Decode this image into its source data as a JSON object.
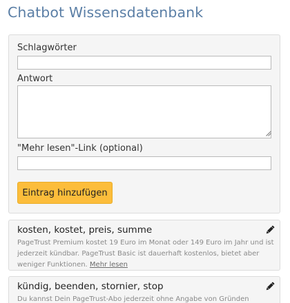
{
  "page": {
    "title": "Chatbot Wissensdatenbank"
  },
  "form": {
    "keywords_label": "Schlagwörter",
    "keywords_value": "",
    "answer_label": "Antwort",
    "answer_value": "",
    "link_label": "\"Mehr lesen\"-Link (optional)",
    "link_value": "",
    "submit_label": "Eintrag hinzufügen"
  },
  "entries": [
    {
      "keywords": "kosten, kostet, preis, summe",
      "answer": "PageTrust Premium kostet 19 Euro im Monat oder 149 Euro im Jahr und ist jederzeit kündbar. PageTrust Basic ist dauerhaft kostenlos, bietet aber weniger Funktionen.",
      "link_text": "Mehr lesen",
      "edit_icon": "pencil-icon"
    },
    {
      "keywords": "kündig, beenden, stornier, stop",
      "answer": "Du kannst Dein PageTrust-Abo jederzeit ohne Angabe von Gründen kündigen.",
      "link_text": "",
      "edit_icon": "pencil-icon"
    }
  ],
  "colors": {
    "title": "#5b7fa6",
    "button": "#fcbd3b",
    "panel_background": "#f5f5f5",
    "panel_border": "#dcdcdc"
  }
}
